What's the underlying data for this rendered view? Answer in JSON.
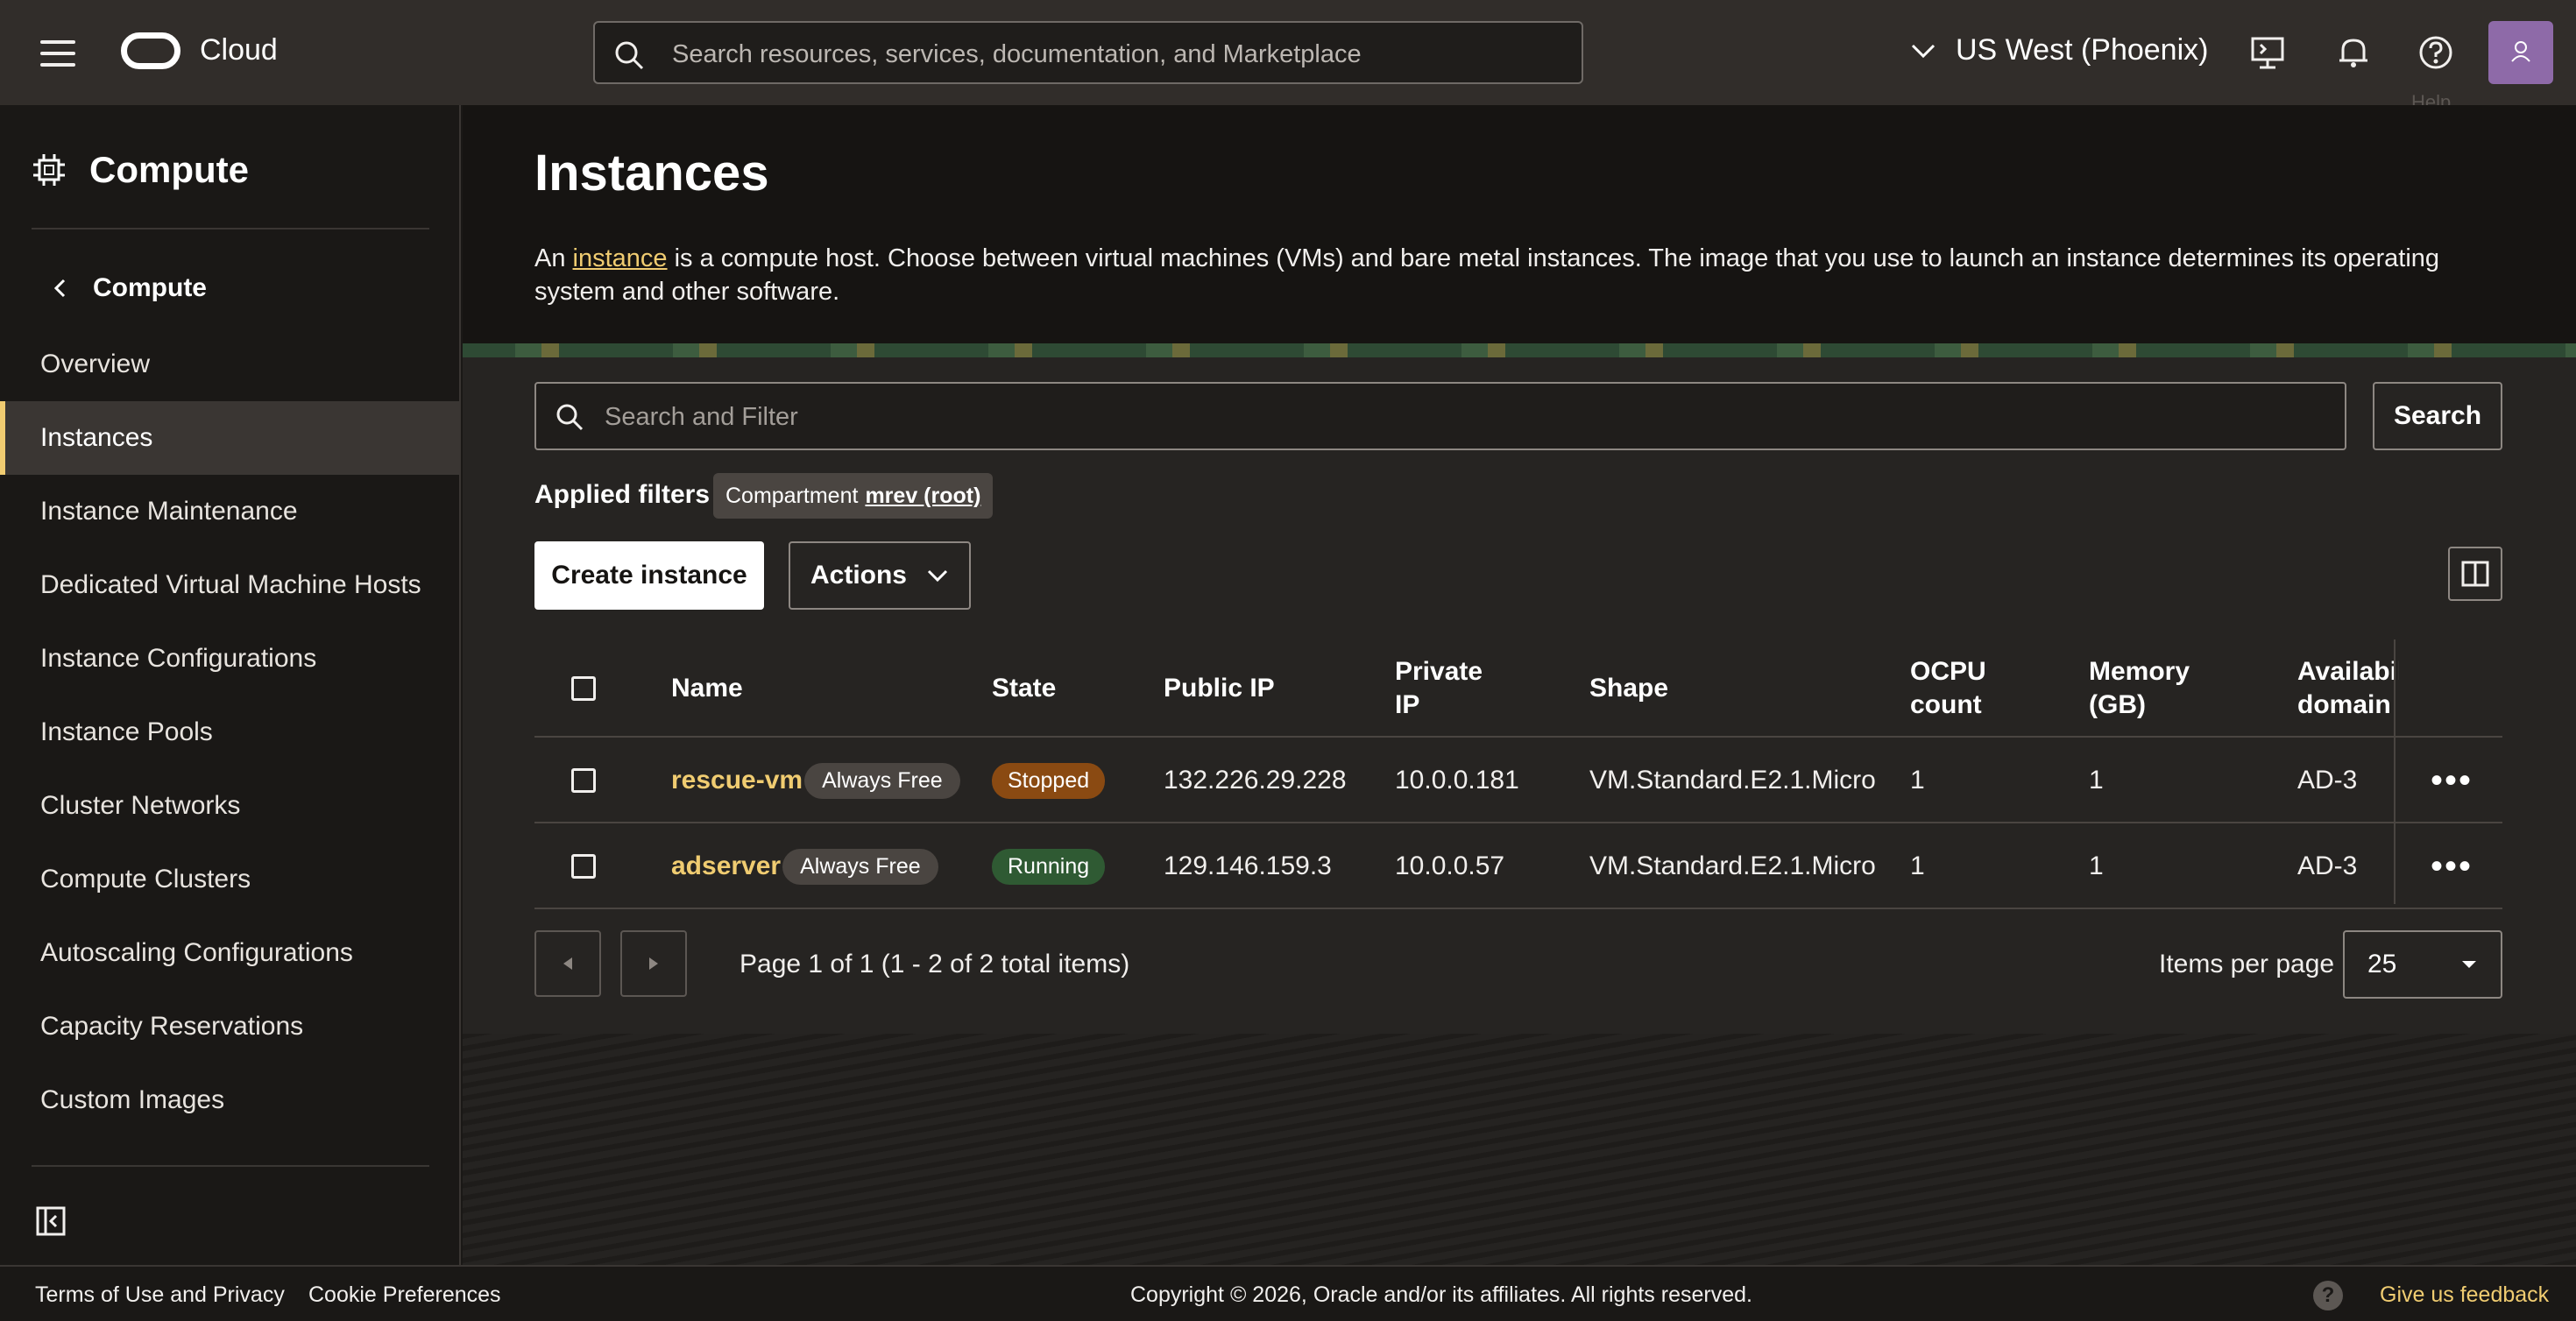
{
  "topbar": {
    "brand": "Cloud",
    "search_placeholder": "Search resources, services, documentation, and Marketplace",
    "region": "US West (Phoenix)",
    "help_tooltip": "Help"
  },
  "sidebar": {
    "title": "Compute",
    "back_label": "Compute",
    "items": [
      {
        "label": "Overview"
      },
      {
        "label": "Instances"
      },
      {
        "label": "Instance Maintenance"
      },
      {
        "label": "Dedicated Virtual Machine Hosts"
      },
      {
        "label": "Instance Configurations"
      },
      {
        "label": "Instance Pools"
      },
      {
        "label": "Cluster Networks"
      },
      {
        "label": "Compute Clusters"
      },
      {
        "label": "Autoscaling Configurations"
      },
      {
        "label": "Capacity Reservations"
      },
      {
        "label": "Custom Images"
      }
    ],
    "active": "Instances"
  },
  "page": {
    "title": "Instances",
    "desc_prefix": "An ",
    "desc_link": "instance",
    "desc_suffix": " is a compute host. Choose between virtual machines (VMs) and bare metal instances. The image that you use to launch an instance determines its operating system and other software."
  },
  "filters": {
    "search_placeholder": "Search and Filter",
    "search_button": "Search",
    "applied_label": "Applied filters",
    "chip_key": "Compartment",
    "chip_value": "mrev (root)"
  },
  "toolbar": {
    "create_label": "Create instance",
    "actions_label": "Actions"
  },
  "table": {
    "headers": {
      "name": "Name",
      "state": "State",
      "public_ip": "Public IP",
      "private_ip_1": "Private",
      "private_ip_2": "IP",
      "shape": "Shape",
      "ocpu_1": "OCPU",
      "ocpu_2": "count",
      "memory_1": "Memory",
      "memory_2": "(GB)",
      "ad_1": "Availabili",
      "ad_2": "domain"
    },
    "rows": [
      {
        "name": "rescue-vm",
        "tag": "Always Free",
        "state": "Stopped",
        "public_ip": "132.226.29.228",
        "private_ip": "10.0.0.181",
        "shape": "VM.Standard.E2.1.Micro",
        "ocpu": "1",
        "memory": "1",
        "ad": "AD-3"
      },
      {
        "name": "adserver",
        "tag": "Always Free",
        "state": "Running",
        "public_ip": "129.146.159.3",
        "private_ip": "10.0.0.57",
        "shape": "VM.Standard.E2.1.Micro",
        "ocpu": "1",
        "memory": "1",
        "ad": "AD-3"
      }
    ]
  },
  "pagination": {
    "text": "Page 1 of 1 (1 - 2 of 2 total items)",
    "items_per_page_label": "Items per page",
    "items_per_page_value": "25"
  },
  "footer": {
    "terms": "Terms of Use and Privacy",
    "cookies": "Cookie Preferences",
    "copyright": "Copyright © 2026, Oracle and/or its affiliates. All rights reserved.",
    "help": "?",
    "feedback": "Give us feedback"
  },
  "colors": {
    "accent": "#f0cc71",
    "topbar": "#312d2a",
    "stopped": "#8a4a12",
    "running": "#2f5a33"
  }
}
